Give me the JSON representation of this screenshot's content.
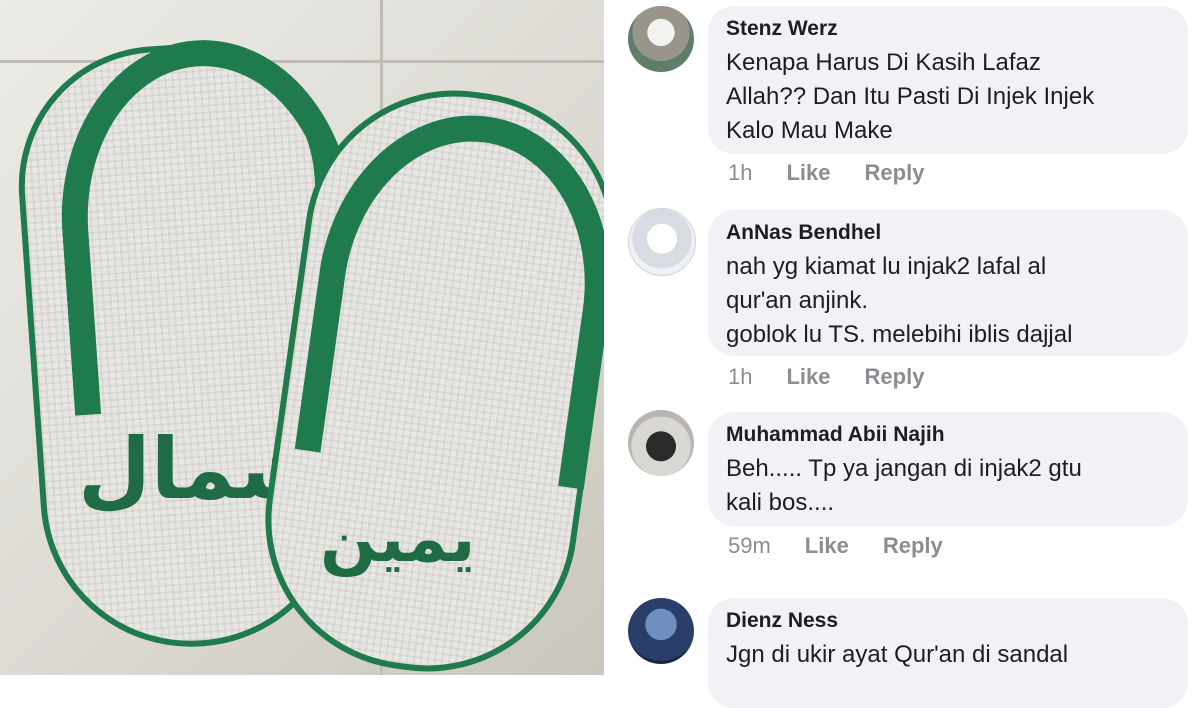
{
  "photo": {
    "left_sandal_text": "شمال",
    "right_sandal_text": "يمين"
  },
  "comments": [
    {
      "author": "Stenz Werz",
      "text": "Kenapa Harus Di Kasih Lafaz\nAllah?? Dan Itu Pasti Di Injek Injek\nKalo Mau Make",
      "time": "1h",
      "like_label": "Like",
      "reply_label": "Reply",
      "avatar_icon": "cat-avatar-icon"
    },
    {
      "author": "AnNas Bendhel",
      "text": "nah yg kiamat lu injak2 lafal al\nqur'an anjink.\ngoblok lu TS. melebihi iblis dajjal",
      "time": "1h",
      "like_label": "Like",
      "reply_label": "Reply",
      "avatar_icon": "anime-avatar-icon"
    },
    {
      "author": "Muhammad Abii Najih",
      "text": "Beh..... Tp ya jangan di injak2 gtu\nkali bos....",
      "time": "59m",
      "like_label": "Like",
      "reply_label": "Reply",
      "avatar_icon": "person-avatar-icon"
    },
    {
      "author": "Dienz Ness",
      "text": "Jgn di ukir ayat Qur'an di sandal",
      "time": "",
      "like_label": "",
      "reply_label": "",
      "avatar_icon": "ramadan-avatar-icon"
    }
  ],
  "colors": {
    "sandal_green": "#1f7a4e",
    "bubble_bg": "#f0f2f5",
    "meta_gray": "#8a8d91"
  }
}
